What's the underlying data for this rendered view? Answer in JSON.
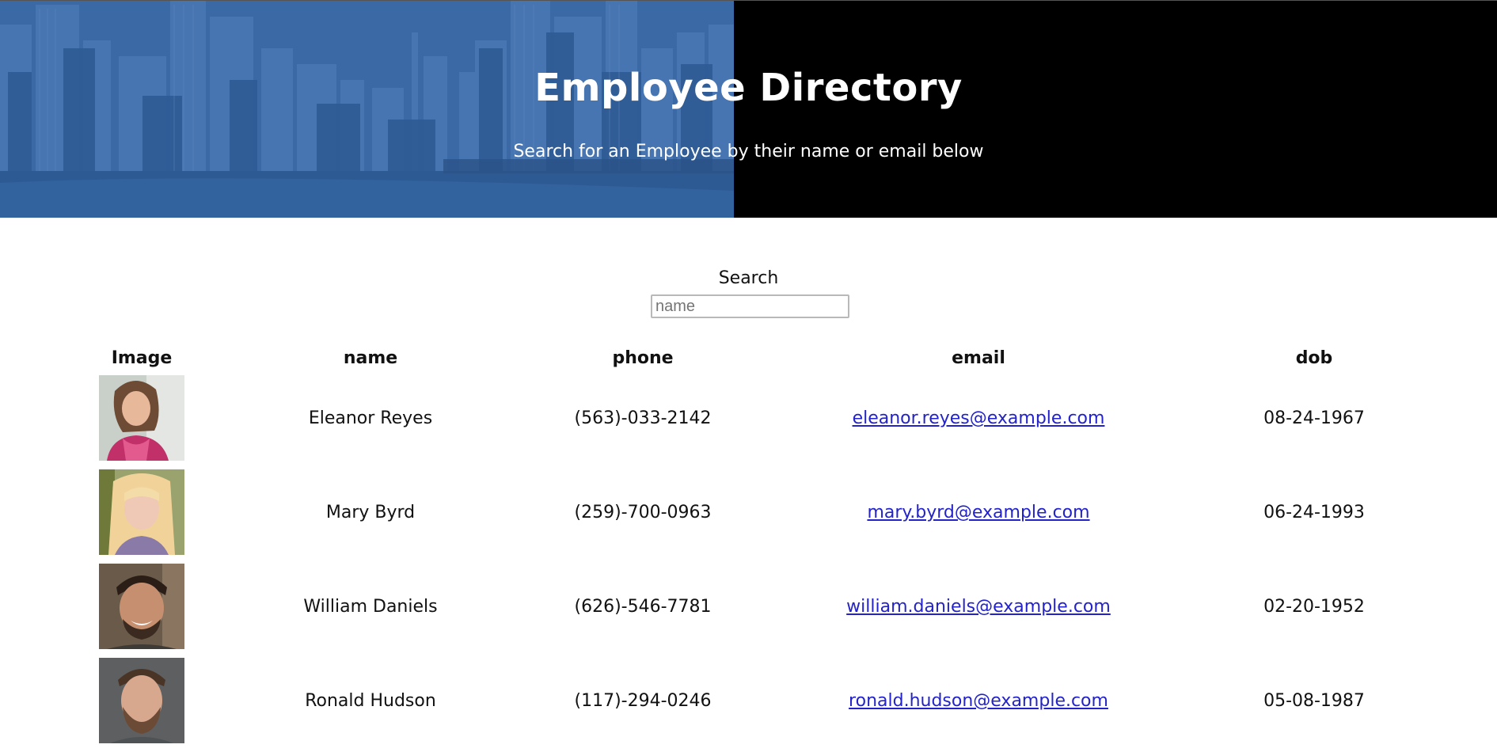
{
  "header": {
    "title": "Employee Directory",
    "subtitle": "Search for an Employee by their name or email below"
  },
  "search": {
    "label": "Search",
    "placeholder": "name",
    "value": ""
  },
  "table": {
    "columns": [
      "Image",
      "name",
      "phone",
      "email",
      "dob"
    ],
    "rows": [
      {
        "name": "Eleanor Reyes",
        "phone": "(563)-033-2142",
        "email": "eleanor.reyes@example.com",
        "dob": "08-24-1967",
        "avatar": "woman-pink-jacket-avatar"
      },
      {
        "name": "Mary Byrd",
        "phone": "(259)-700-0963",
        "email": "mary.byrd@example.com",
        "dob": "06-24-1993",
        "avatar": "woman-blonde-avatar"
      },
      {
        "name": "William Daniels",
        "phone": "(626)-546-7781",
        "email": "william.daniels@example.com",
        "dob": "02-20-1952",
        "avatar": "man-smiling-avatar"
      },
      {
        "name": "Ronald Hudson",
        "phone": "(117)-294-0246",
        "email": "ronald.hudson@example.com",
        "dob": "05-08-1987",
        "avatar": "man-beard-avatar"
      }
    ]
  },
  "colors": {
    "hero_blue": "#3a67a3",
    "hero_dark": "#000000",
    "link": "#2323c9"
  }
}
